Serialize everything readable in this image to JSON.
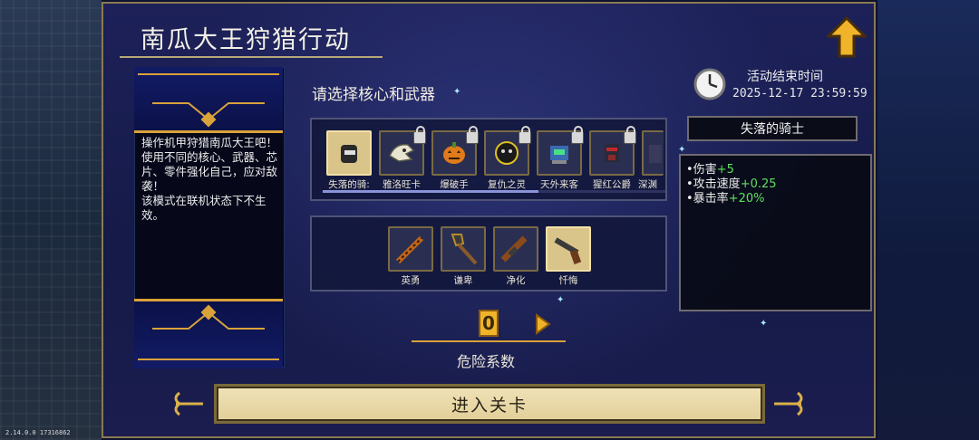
{
  "version": "2.14.0.0 17316862",
  "title": "南瓜大王狩猎行动",
  "description": "操作机甲狩猎南瓜大王吧！使用不同的核心、武器、芯片、零件强化自己，应对敌袭！\n该模式在联机状态下不生效。",
  "prompt": "请选择核心和武器",
  "cores": [
    {
      "label": "失落的骑:",
      "icon": "knight-helmet-icon",
      "locked": false,
      "selected": true
    },
    {
      "label": "雅洛旺卡",
      "icon": "bone-beast-icon",
      "locked": true,
      "selected": false
    },
    {
      "label": "爆破手",
      "icon": "pumpkin-bomb-icon",
      "locked": true,
      "selected": false
    },
    {
      "label": "复仇之灵",
      "icon": "dark-spirit-icon",
      "locked": true,
      "selected": false
    },
    {
      "label": "天外来客",
      "icon": "alien-robot-icon",
      "locked": true,
      "selected": false
    },
    {
      "label": "猩红公爵",
      "icon": "crimson-duke-icon",
      "locked": true,
      "selected": false
    },
    {
      "label": "深渊",
      "icon": "abyss-icon",
      "locked": false,
      "selected": false
    }
  ],
  "weapons": [
    {
      "label": "英勇",
      "icon": "chainsword-icon",
      "selected": false
    },
    {
      "label": "谦卑",
      "icon": "shovel-icon",
      "selected": false
    },
    {
      "label": "净化",
      "icon": "bazooka-icon",
      "selected": false
    },
    {
      "label": "忏悔",
      "icon": "revolver-icon",
      "selected": true
    }
  ],
  "danger": {
    "value": "0",
    "label": "危险系数"
  },
  "event_end": {
    "title": "活动结束时间",
    "time": "2025-12-17 23:59:59"
  },
  "selected_core_name": "失落的骑士",
  "stats": [
    {
      "name": "伤害",
      "value": "+5"
    },
    {
      "name": "攻击速度",
      "value": "+0.25"
    },
    {
      "name": "暴击率",
      "value": "+20%"
    }
  ],
  "enter_button": "进入关卡",
  "colors": {
    "accent_gold": "#d9a23a",
    "stat_green": "#5ee05e",
    "panel_bg": "#151a48"
  }
}
